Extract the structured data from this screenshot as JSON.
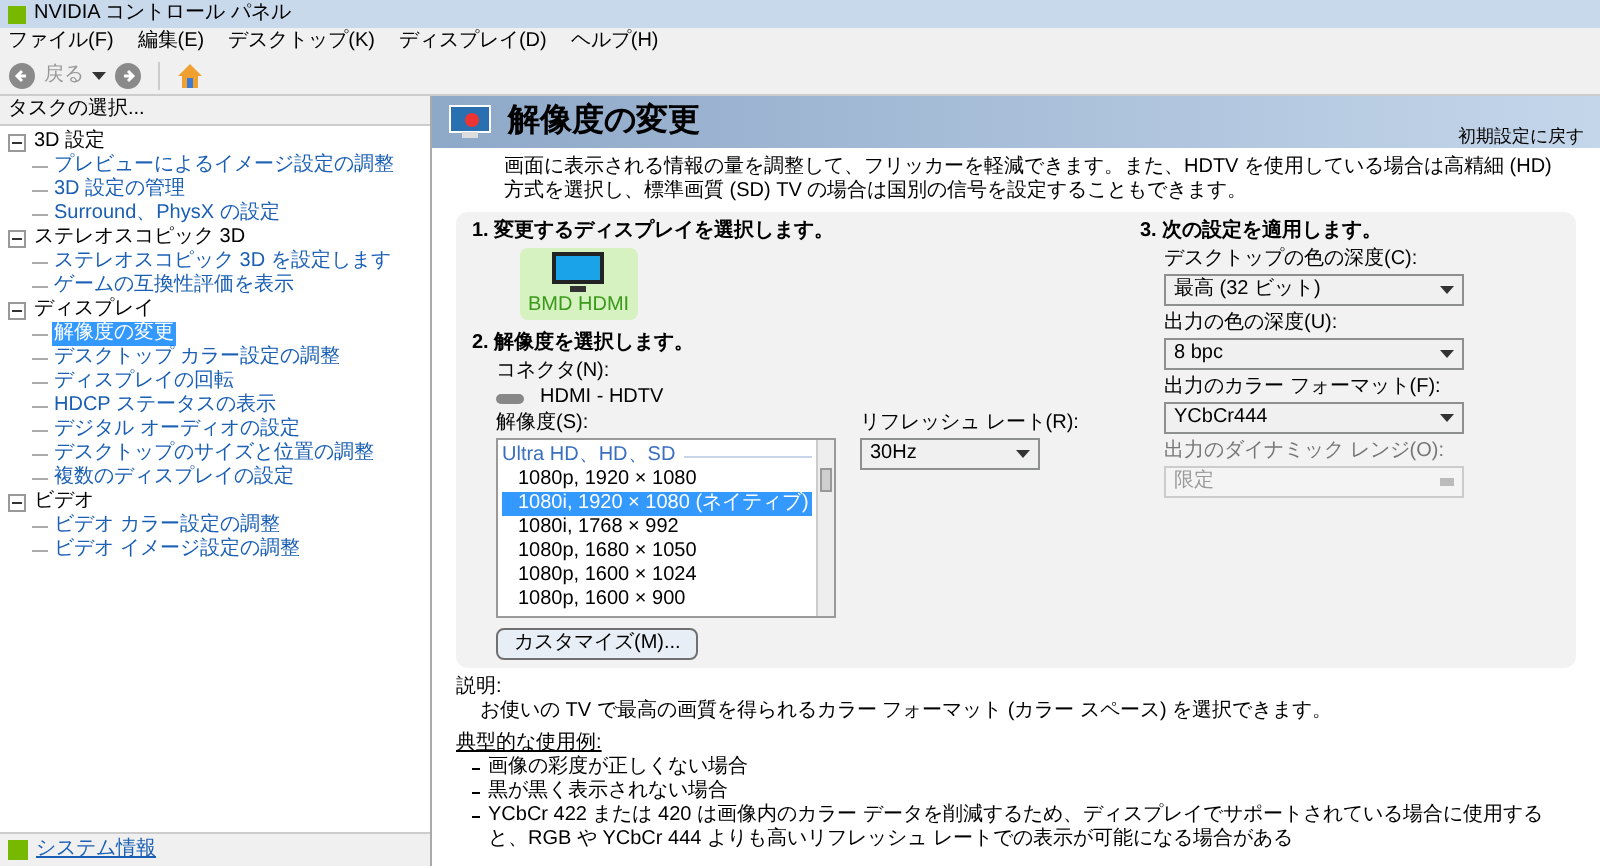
{
  "window": {
    "title": "NVIDIA コントロール パネル"
  },
  "menu": [
    "ファイル(F)",
    "編集(E)",
    "デスクトップ(K)",
    "ディスプレイ(D)",
    "ヘルプ(H)"
  ],
  "toolbar": {
    "back_label": "戻る"
  },
  "sidebar": {
    "heading": "タスクの選択...",
    "tree": [
      {
        "label": "3D 設定",
        "expanded": true,
        "children": [
          {
            "label": "プレビューによるイメージ設定の調整",
            "selected": false
          },
          {
            "label": "3D 設定の管理",
            "selected": false
          },
          {
            "label": "Surround、PhysX の設定",
            "selected": false
          }
        ]
      },
      {
        "label": "ステレオスコピック 3D",
        "expanded": true,
        "children": [
          {
            "label": "ステレオスコピック 3D を設定します",
            "selected": false
          },
          {
            "label": "ゲームの互換性評価を表示",
            "selected": false
          }
        ]
      },
      {
        "label": "ディスプレイ",
        "expanded": true,
        "children": [
          {
            "label": "解像度の変更",
            "selected": true
          },
          {
            "label": "デスクトップ カラー設定の調整",
            "selected": false
          },
          {
            "label": "ディスプレイの回転",
            "selected": false
          },
          {
            "label": "HDCP ステータスの表示",
            "selected": false
          },
          {
            "label": "デジタル オーディオの設定",
            "selected": false
          },
          {
            "label": "デスクトップのサイズと位置の調整",
            "selected": false
          },
          {
            "label": "複数のディスプレイの設定",
            "selected": false
          }
        ]
      },
      {
        "label": "ビデオ",
        "expanded": true,
        "children": [
          {
            "label": "ビデオ カラー設定の調整",
            "selected": false
          },
          {
            "label": "ビデオ イメージ設定の調整",
            "selected": false
          }
        ]
      }
    ],
    "footer_link": "システム情報"
  },
  "page": {
    "title": "解像度の変更",
    "restore_link": "初期設定に戻す",
    "description": "画面に表示される情報の量を調整して、フリッカーを軽減できます。また、HDTV を使用している場合は高精細 (HD) 方式を選択し、標準画質 (SD) TV の場合は国別の信号を設定することもできます。",
    "section1": {
      "title": "1. 変更するディスプレイを選択します。",
      "displays": [
        {
          "name": "BMD HDMI",
          "selected": true
        }
      ]
    },
    "section2": {
      "title": "2. 解像度を選択します。",
      "connector_label": "コネクタ(N):",
      "connector": "HDMI - HDTV",
      "resolution_label": "解像度(S):",
      "group": "Ultra HD、HD、SD",
      "resolutions": [
        {
          "label": "1080p, 1920 × 1080",
          "selected": false
        },
        {
          "label": "1080i, 1920 × 1080 (ネイティブ)",
          "selected": true
        },
        {
          "label": "1080i, 1768 × 992",
          "selected": false
        },
        {
          "label": "1080p, 1680 × 1050",
          "selected": false
        },
        {
          "label": "1080p, 1600 × 1024",
          "selected": false
        },
        {
          "label": "1080p, 1600 × 900",
          "selected": false
        }
      ],
      "refresh_label": "リフレッシュ レート(R):",
      "refresh_value": "30Hz",
      "customize_button": "カスタマイズ(M)..."
    },
    "section3": {
      "title": "3. 次の設定を適用します。",
      "fields": [
        {
          "label": "デスクトップの色の深度(C):",
          "value": "最高 (32 ビット)",
          "disabled": false
        },
        {
          "label": "出力の色の深度(U):",
          "value": "8 bpc",
          "disabled": false
        },
        {
          "label": "出力のカラー フォーマット(F):",
          "value": "YCbCr444",
          "disabled": false
        },
        {
          "label": "出力のダイナミック レンジ(O):",
          "value": "限定",
          "disabled": true
        }
      ]
    },
    "explanation": {
      "label": "説明:",
      "text": "お使いの TV で最高の画質を得られるカラー フォーマット (カラー スペース) を選択できます。"
    },
    "typical": {
      "label": "典型的な使用例:",
      "items": [
        "画像の彩度が正しくない場合",
        "黒が黒く表示されない場合",
        "YCbCr 422 または 420 は画像内のカラー データを削減するため、ディスプレイでサポートされている場合に使用すると、RGB や YCbCr 444 よりも高いリフレッシュ レートでの表示が可能になる場合がある"
      ]
    }
  }
}
